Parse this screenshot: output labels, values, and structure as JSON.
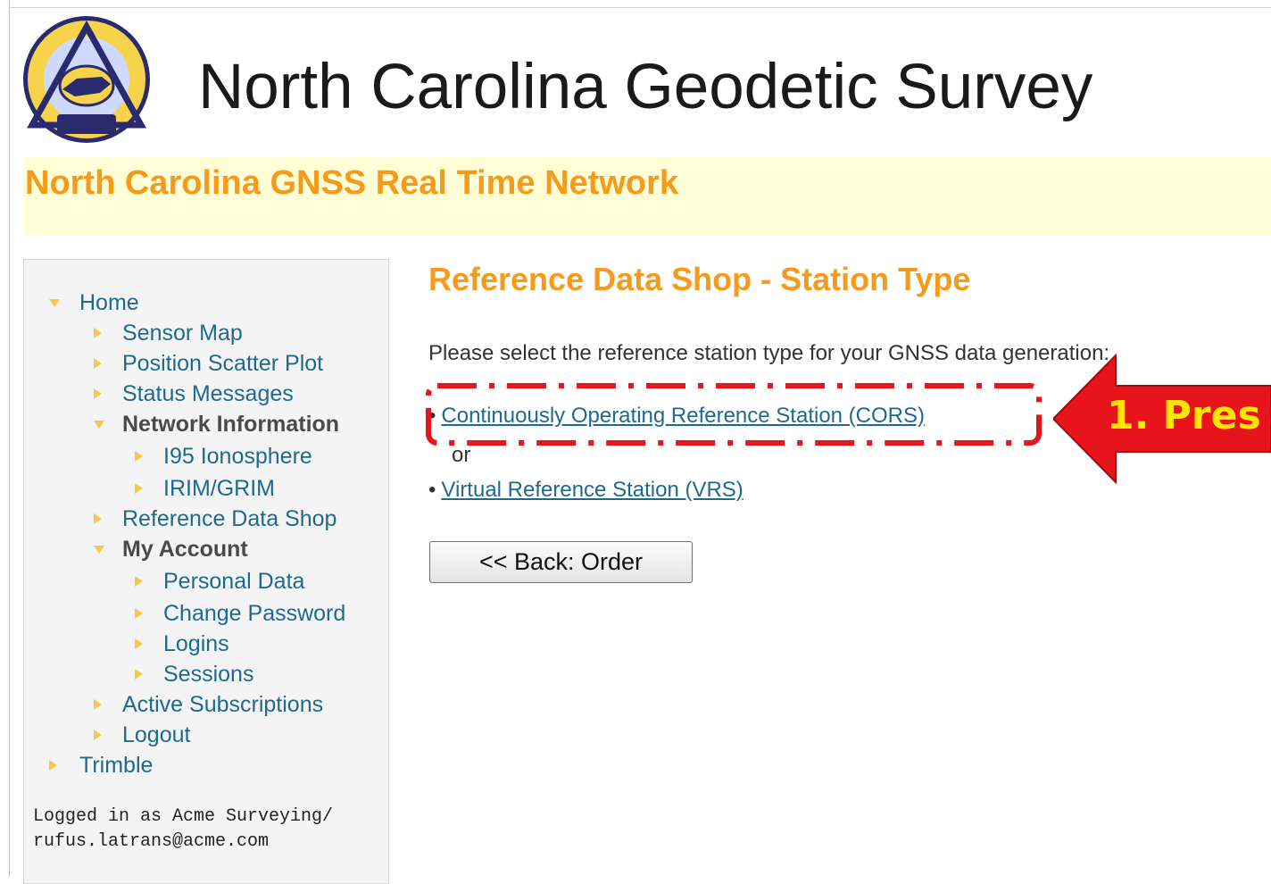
{
  "header": {
    "site_title": "North Carolina Geodetic Survey",
    "banner_title": "North Carolina GNSS Real Time Network",
    "logo": {
      "icon": "ncgs-seal-logo",
      "text_top": "NORTH CAROLINA",
      "text_bottom": "Geodetic Survey"
    }
  },
  "sidebar": {
    "items": [
      {
        "label": "Home",
        "icon": "arrow-down-icon"
      },
      {
        "label": "Sensor Map",
        "icon": "arrow-right-icon"
      },
      {
        "label": "Position Scatter Plot",
        "icon": "arrow-right-icon"
      },
      {
        "label": "Status Messages",
        "icon": "arrow-right-icon"
      },
      {
        "label": "Network Information",
        "icon": "arrow-down-icon"
      },
      {
        "label": "I95 Ionosphere",
        "icon": "arrow-right-icon"
      },
      {
        "label": "IRIM/GRIM",
        "icon": "arrow-right-icon"
      },
      {
        "label": "Reference Data Shop",
        "icon": "arrow-right-icon"
      },
      {
        "label": "My Account",
        "icon": "arrow-down-icon"
      },
      {
        "label": "Personal Data",
        "icon": "arrow-right-icon"
      },
      {
        "label": "Change Password",
        "icon": "arrow-right-icon"
      },
      {
        "label": "Logins",
        "icon": "arrow-right-icon"
      },
      {
        "label": "Sessions",
        "icon": "arrow-right-icon"
      },
      {
        "label": "Active Subscriptions",
        "icon": "arrow-right-icon"
      },
      {
        "label": "Logout",
        "icon": "arrow-right-icon"
      },
      {
        "label": "Trimble",
        "icon": "arrow-right-icon"
      }
    ],
    "logged_in_line1": "Logged in as Acme Surveying/",
    "logged_in_line2": "rufus.latrans@acme.com"
  },
  "main": {
    "heading": "Reference Data Shop - Station Type",
    "instruction": "Please select the reference station type for your GNSS data generation:",
    "bullet": "•",
    "option_cors": "Continuously Operating Reference Station (CORS)",
    "or_text": "or",
    "option_vrs": "Virtual Reference Station (VRS)",
    "back_button": "<< Back: Order"
  },
  "annotation": {
    "callout_text": "1. Pres",
    "colors": {
      "arrow": "#e8141b",
      "text": "#ffe600",
      "dash": "#e8141b"
    }
  },
  "colors": {
    "accent_orange": "#f59a1b",
    "link_blue": "#1e6a8f",
    "banner_bg": "#fffed6",
    "sidebar_bg": "#f4f4f4",
    "bullet_arrow": "#f6c84c"
  }
}
